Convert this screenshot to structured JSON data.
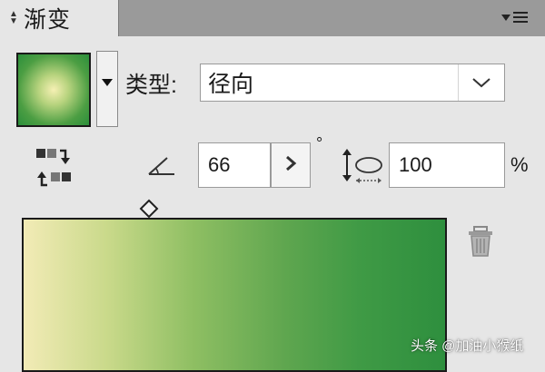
{
  "panel": {
    "title": "渐变",
    "tab_arrows_icon": "up-down-arrows-icon",
    "menu_icon": "panel-menu-icon"
  },
  "swatch": {
    "icon": "gradient-swatch",
    "dropdown_icon": "triangle-down-icon"
  },
  "type": {
    "label": "类型:",
    "value": "径向",
    "dropdown_icon": "chevron-down-icon"
  },
  "angle": {
    "icon": "angle-icon",
    "value": "66",
    "unit": "°",
    "stepper_icon": "chevron-right-icon"
  },
  "aspect": {
    "icon": "aspect-ratio-icon",
    "value": "100",
    "unit": "%"
  },
  "reverse": {
    "icon": "reverse-gradient-icon"
  },
  "slider": {
    "stop_icon": "diamond-midpoint-icon",
    "colors": {
      "start": "#f2ebb6",
      "end": "#2e8f3e"
    },
    "delete_icon": "trash-icon"
  },
  "watermark": "头条 @加油小猴纸"
}
